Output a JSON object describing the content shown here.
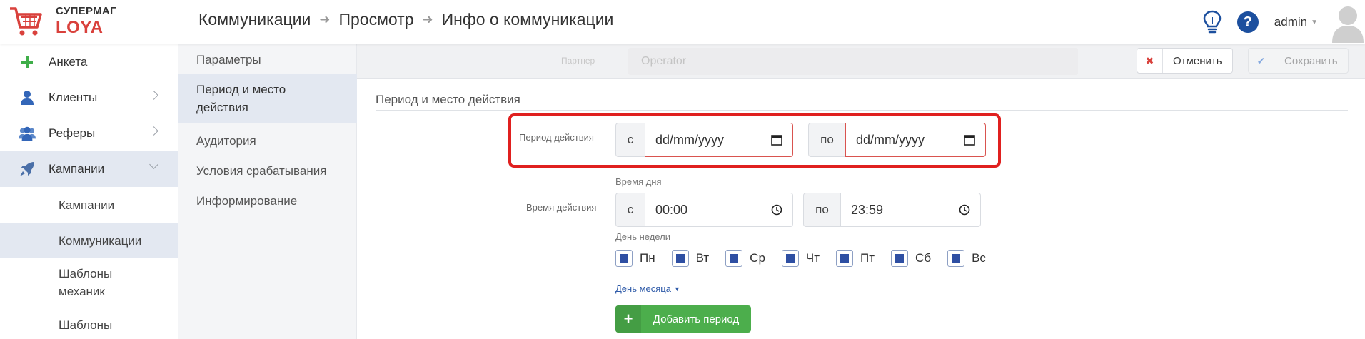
{
  "brand": {
    "line1": "СУПЕРМАГ",
    "line2": "LOYA"
  },
  "breadcrumbs": [
    {
      "label": "Коммуникации"
    },
    {
      "label": "Просмотр"
    },
    {
      "label": "Инфо о коммуникации"
    }
  ],
  "header": {
    "user_name": "admin",
    "help_label": "?"
  },
  "sidebar": {
    "items": [
      {
        "label": "Анкета",
        "icon": "plus-icon"
      },
      {
        "label": "Клиенты",
        "icon": "user-icon"
      },
      {
        "label": "Реферы",
        "icon": "users-icon"
      },
      {
        "label": "Кампании",
        "icon": "rocket-icon"
      }
    ],
    "subitems": [
      {
        "label": "Кампании"
      },
      {
        "label": "Коммуникации"
      },
      {
        "label": "Шаблоны механик"
      },
      {
        "label": "Шаблоны"
      }
    ]
  },
  "subnav": {
    "items": [
      {
        "label": "Параметры"
      },
      {
        "label": "Период и место действия"
      },
      {
        "label": "Аудитория"
      },
      {
        "label": "Условия срабатывания"
      },
      {
        "label": "Информирование"
      }
    ]
  },
  "toolbar": {
    "partner_label": "Партнер",
    "partner_value": "Operator",
    "cancel_label": "Отменить",
    "save_label": "Сохранить"
  },
  "form": {
    "section_title": "Период и место действия",
    "period_label": "Период действия",
    "from_addon": "с",
    "to_addon": "по",
    "date_from": "dd/mm/yyyy",
    "date_to": "dd/mm/yyyy",
    "time_of_day_hint": "Время дня",
    "time_label": "Время действия",
    "time_from": "00:00",
    "time_to": "23:59",
    "weekday_hint": "День недели",
    "days": [
      "Пн",
      "Вт",
      "Ср",
      "Чт",
      "Пт",
      "Сб",
      "Вс"
    ],
    "month_day_link": "День месяца",
    "add_period_label": "Добавить период"
  },
  "colors": {
    "accent_red": "#d9413c",
    "nav_active": "#e3e8f1",
    "primary_blue": "#1c4f9e",
    "success_green": "#4cae4c",
    "highlight_red": "#e0201f"
  }
}
